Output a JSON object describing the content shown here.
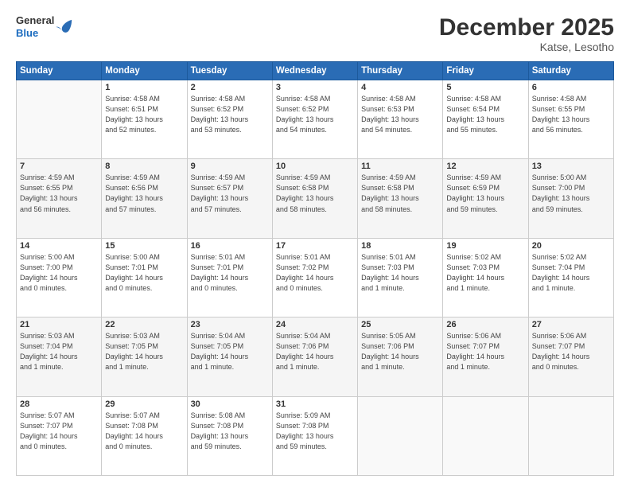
{
  "logo": {
    "general": "General",
    "blue": "Blue"
  },
  "title": "December 2025",
  "subtitle": "Katse, Lesotho",
  "headers": [
    "Sunday",
    "Monday",
    "Tuesday",
    "Wednesday",
    "Thursday",
    "Friday",
    "Saturday"
  ],
  "weeks": [
    [
      {
        "day": "",
        "info": ""
      },
      {
        "day": "1",
        "info": "Sunrise: 4:58 AM\nSunset: 6:51 PM\nDaylight: 13 hours\nand 52 minutes."
      },
      {
        "day": "2",
        "info": "Sunrise: 4:58 AM\nSunset: 6:52 PM\nDaylight: 13 hours\nand 53 minutes."
      },
      {
        "day": "3",
        "info": "Sunrise: 4:58 AM\nSunset: 6:52 PM\nDaylight: 13 hours\nand 54 minutes."
      },
      {
        "day": "4",
        "info": "Sunrise: 4:58 AM\nSunset: 6:53 PM\nDaylight: 13 hours\nand 54 minutes."
      },
      {
        "day": "5",
        "info": "Sunrise: 4:58 AM\nSunset: 6:54 PM\nDaylight: 13 hours\nand 55 minutes."
      },
      {
        "day": "6",
        "info": "Sunrise: 4:58 AM\nSunset: 6:55 PM\nDaylight: 13 hours\nand 56 minutes."
      }
    ],
    [
      {
        "day": "7",
        "info": "Sunrise: 4:59 AM\nSunset: 6:55 PM\nDaylight: 13 hours\nand 56 minutes."
      },
      {
        "day": "8",
        "info": "Sunrise: 4:59 AM\nSunset: 6:56 PM\nDaylight: 13 hours\nand 57 minutes."
      },
      {
        "day": "9",
        "info": "Sunrise: 4:59 AM\nSunset: 6:57 PM\nDaylight: 13 hours\nand 57 minutes."
      },
      {
        "day": "10",
        "info": "Sunrise: 4:59 AM\nSunset: 6:58 PM\nDaylight: 13 hours\nand 58 minutes."
      },
      {
        "day": "11",
        "info": "Sunrise: 4:59 AM\nSunset: 6:58 PM\nDaylight: 13 hours\nand 58 minutes."
      },
      {
        "day": "12",
        "info": "Sunrise: 4:59 AM\nSunset: 6:59 PM\nDaylight: 13 hours\nand 59 minutes."
      },
      {
        "day": "13",
        "info": "Sunrise: 5:00 AM\nSunset: 7:00 PM\nDaylight: 13 hours\nand 59 minutes."
      }
    ],
    [
      {
        "day": "14",
        "info": "Sunrise: 5:00 AM\nSunset: 7:00 PM\nDaylight: 14 hours\nand 0 minutes."
      },
      {
        "day": "15",
        "info": "Sunrise: 5:00 AM\nSunset: 7:01 PM\nDaylight: 14 hours\nand 0 minutes."
      },
      {
        "day": "16",
        "info": "Sunrise: 5:01 AM\nSunset: 7:01 PM\nDaylight: 14 hours\nand 0 minutes."
      },
      {
        "day": "17",
        "info": "Sunrise: 5:01 AM\nSunset: 7:02 PM\nDaylight: 14 hours\nand 0 minutes."
      },
      {
        "day": "18",
        "info": "Sunrise: 5:01 AM\nSunset: 7:03 PM\nDaylight: 14 hours\nand 1 minute."
      },
      {
        "day": "19",
        "info": "Sunrise: 5:02 AM\nSunset: 7:03 PM\nDaylight: 14 hours\nand 1 minute."
      },
      {
        "day": "20",
        "info": "Sunrise: 5:02 AM\nSunset: 7:04 PM\nDaylight: 14 hours\nand 1 minute."
      }
    ],
    [
      {
        "day": "21",
        "info": "Sunrise: 5:03 AM\nSunset: 7:04 PM\nDaylight: 14 hours\nand 1 minute."
      },
      {
        "day": "22",
        "info": "Sunrise: 5:03 AM\nSunset: 7:05 PM\nDaylight: 14 hours\nand 1 minute."
      },
      {
        "day": "23",
        "info": "Sunrise: 5:04 AM\nSunset: 7:05 PM\nDaylight: 14 hours\nand 1 minute."
      },
      {
        "day": "24",
        "info": "Sunrise: 5:04 AM\nSunset: 7:06 PM\nDaylight: 14 hours\nand 1 minute."
      },
      {
        "day": "25",
        "info": "Sunrise: 5:05 AM\nSunset: 7:06 PM\nDaylight: 14 hours\nand 1 minute."
      },
      {
        "day": "26",
        "info": "Sunrise: 5:06 AM\nSunset: 7:07 PM\nDaylight: 14 hours\nand 1 minute."
      },
      {
        "day": "27",
        "info": "Sunrise: 5:06 AM\nSunset: 7:07 PM\nDaylight: 14 hours\nand 0 minutes."
      }
    ],
    [
      {
        "day": "28",
        "info": "Sunrise: 5:07 AM\nSunset: 7:07 PM\nDaylight: 14 hours\nand 0 minutes."
      },
      {
        "day": "29",
        "info": "Sunrise: 5:07 AM\nSunset: 7:08 PM\nDaylight: 14 hours\nand 0 minutes."
      },
      {
        "day": "30",
        "info": "Sunrise: 5:08 AM\nSunset: 7:08 PM\nDaylight: 13 hours\nand 59 minutes."
      },
      {
        "day": "31",
        "info": "Sunrise: 5:09 AM\nSunset: 7:08 PM\nDaylight: 13 hours\nand 59 minutes."
      },
      {
        "day": "",
        "info": ""
      },
      {
        "day": "",
        "info": ""
      },
      {
        "day": "",
        "info": ""
      }
    ]
  ]
}
